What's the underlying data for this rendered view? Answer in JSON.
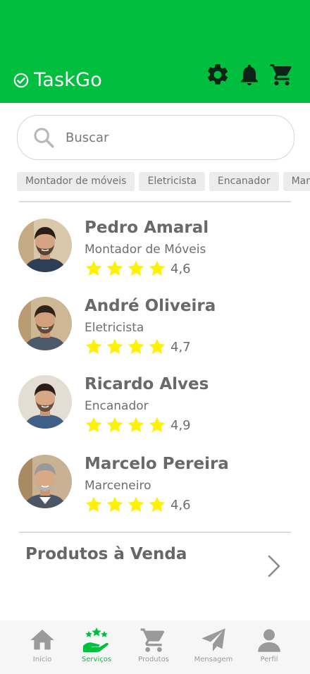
{
  "app": {
    "name": "TaskGo"
  },
  "colors": {
    "brand_green": "#00bf3f",
    "header_icon": "#0c2417",
    "star": "#fff200",
    "nav_inactive": "#9a9a9a"
  },
  "header": {
    "icons": [
      "gear-icon",
      "bell-icon",
      "cart-icon"
    ]
  },
  "search": {
    "placeholder": "Buscar",
    "value": ""
  },
  "categories": [
    "Montador de móveis",
    "Eletricista",
    "Encanador",
    "Marceneiro"
  ],
  "professionals": [
    {
      "name": "Pedro Amaral",
      "profession": "Montador de Móveis",
      "rating": "4,6",
      "stars": 4
    },
    {
      "name": "André Oliveira",
      "profession": "Eletricista",
      "rating": "4,7",
      "stars": 4
    },
    {
      "name": "Ricardo Alves",
      "profession": "Encanador",
      "rating": "4,9",
      "stars": 4
    },
    {
      "name": "Marcelo Pereira",
      "profession": "Marceneiro",
      "rating": "4,6",
      "stars": 4
    }
  ],
  "section": {
    "products_title": "Produtos à Venda"
  },
  "bottom_nav": [
    {
      "label": "Início",
      "icon": "home-icon",
      "active": false
    },
    {
      "label": "Serviços",
      "icon": "services-icon",
      "active": true
    },
    {
      "label": "Produtos",
      "icon": "cart-icon",
      "active": false
    },
    {
      "label": "Mensagem",
      "icon": "send-icon",
      "active": false
    },
    {
      "label": "Perfil",
      "icon": "person-icon",
      "active": false
    }
  ]
}
